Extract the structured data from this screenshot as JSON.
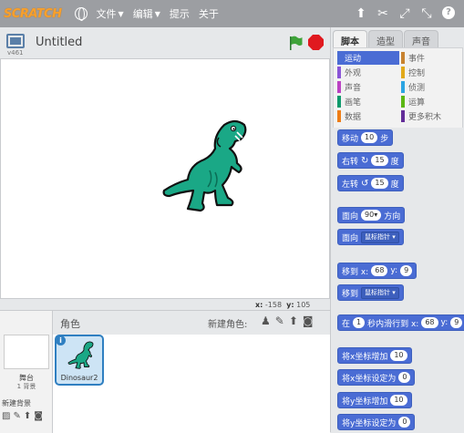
{
  "menubar": {
    "logo": "SCRATCH",
    "items": [
      "文件",
      "编辑",
      "提示",
      "关于"
    ]
  },
  "stage": {
    "version": "v461",
    "project_title": "Untitled",
    "mouse_x_label": "x:",
    "mouse_x": "-158",
    "mouse_y_label": "y:",
    "mouse_y": "105"
  },
  "sprites": {
    "title": "角色",
    "new_sprite_label": "新建角色:",
    "stage_label": "舞台",
    "stage_backdrops": "1 背景",
    "new_backdrop_label": "新建背景",
    "list": [
      {
        "name": "Dinosaur2"
      }
    ]
  },
  "blocks_panel": {
    "tabs": [
      "脚本",
      "造型",
      "声音"
    ],
    "active_tab": "脚本",
    "categories": [
      {
        "label": "运动",
        "color": "#4a6cd4"
      },
      {
        "label": "事件",
        "color": "#c88330"
      },
      {
        "label": "外观",
        "color": "#8a55d7"
      },
      {
        "label": "控制",
        "color": "#e1a91a"
      },
      {
        "label": "声音",
        "color": "#bb42c3"
      },
      {
        "label": "侦测",
        "color": "#2ca5e2"
      },
      {
        "label": "画笔",
        "color": "#0e9a6c"
      },
      {
        "label": "运算",
        "color": "#5cb712"
      },
      {
        "label": "数据",
        "color": "#ee7d16"
      },
      {
        "label": "更多积木",
        "color": "#632d99"
      }
    ],
    "active_category": "运动",
    "blocks": [
      {
        "before": "移动",
        "value": "10",
        "after": "步"
      },
      {
        "before": "右转",
        "icon": "↻",
        "value": "15",
        "after": "度"
      },
      {
        "before": "左转",
        "icon": "↺",
        "value": "15",
        "after": "度"
      },
      {
        "before": "面向",
        "value": "90▾",
        "after": "方向"
      },
      {
        "before": "面向",
        "dropdown": "鼠标指针"
      },
      {
        "before": "移到 x:",
        "value": "68",
        "mid": "y:",
        "value2": "9"
      },
      {
        "before": "移到",
        "dropdown": "鼠标指针"
      },
      {
        "before": "在",
        "value": "1",
        "mid": "秒内滑行到 x:",
        "value2": "68",
        "mid2": "y:",
        "value3": "9"
      },
      {
        "before": "将x坐标增加",
        "value": "10"
      },
      {
        "before": "将x坐标设定为",
        "value": "0"
      },
      {
        "before": "将y坐标增加",
        "value": "10"
      },
      {
        "before": "将y坐标设定为",
        "value": "0"
      }
    ]
  }
}
